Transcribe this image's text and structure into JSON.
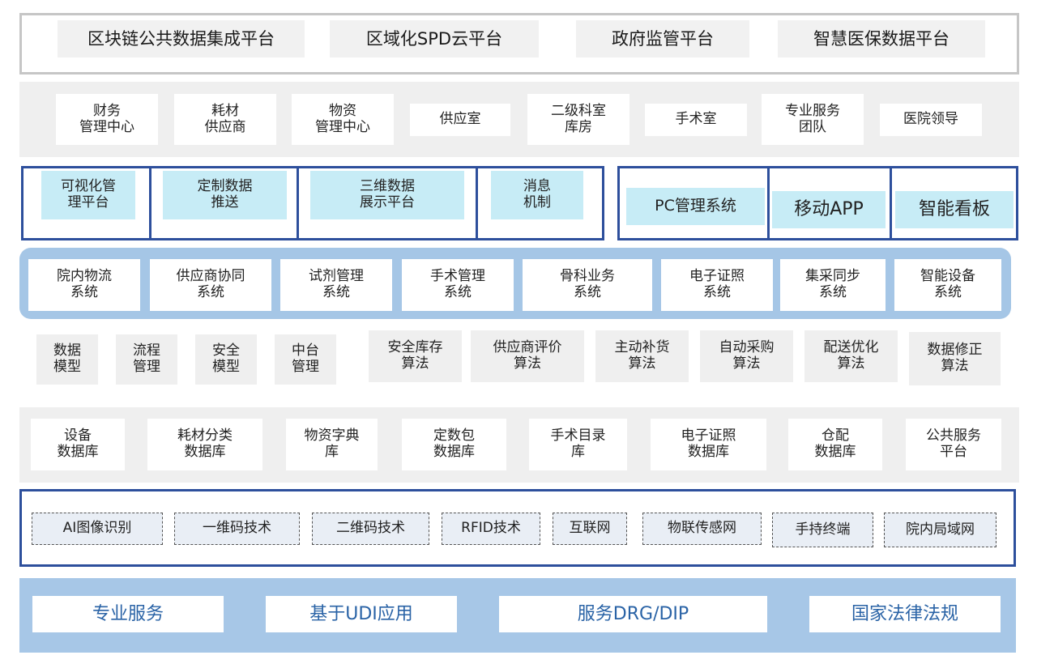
{
  "platforms": [
    "区块链公共数据集成平台",
    "区域化SPD云平台",
    "政府监管平台",
    "智慧医保数据平台"
  ],
  "departments": [
    "财务\n管理中心",
    "耗材\n供应商",
    "物资\n管理中心",
    "供应室",
    "二级科室\n库房",
    "手术室",
    "专业服务\n团队",
    "医院领导"
  ],
  "presentation_left": [
    "可视化管\n理平台",
    "定制数据\n推送",
    "三维数据\n展示平台",
    "消息\n机制"
  ],
  "presentation_right": [
    "PC管理系统",
    "移动APP",
    "智能看板"
  ],
  "systems": [
    "院内物流\n系统",
    "供应商协同\n系统",
    "试剂管理\n系统",
    "手术管理\n系统",
    "骨科业务\n系统",
    "电子证照\n系统",
    "集采同步\n系统",
    "智能设备\n系统"
  ],
  "algorithms": [
    "数据\n模型",
    "流程\n管理",
    "安全\n模型",
    "中台\n管理",
    "安全库存\n算法",
    "供应商评价\n算法",
    "主动补货\n算法",
    "自动采购\n算法",
    "配送优化\n算法",
    "数据修正\n算法"
  ],
  "databases": [
    "设备\n数据库",
    "耗材分类\n数据库",
    "物资字典\n库",
    "定数包\n数据库",
    "手术目录\n库",
    "电子证照\n数据库",
    "仓配\n数据库",
    "公共服务\n平台"
  ],
  "technologies": [
    "AI图像识别",
    "一维码技术",
    "二维码技术",
    "RFID技术",
    "互联网",
    "物联传感网",
    "手持终端",
    "院内局域网"
  ],
  "foundations": [
    "专业服务",
    "基于UDI应用",
    "服务DRG/DIP",
    "国家法律法规"
  ],
  "colors": {
    "frame_blue": "#2d4f9c",
    "cyan_fill": "#c7ecf6",
    "light_blue_band": "#a5c6e6",
    "foundation_text": "#2a63a6",
    "gray_band": "#efefef"
  }
}
